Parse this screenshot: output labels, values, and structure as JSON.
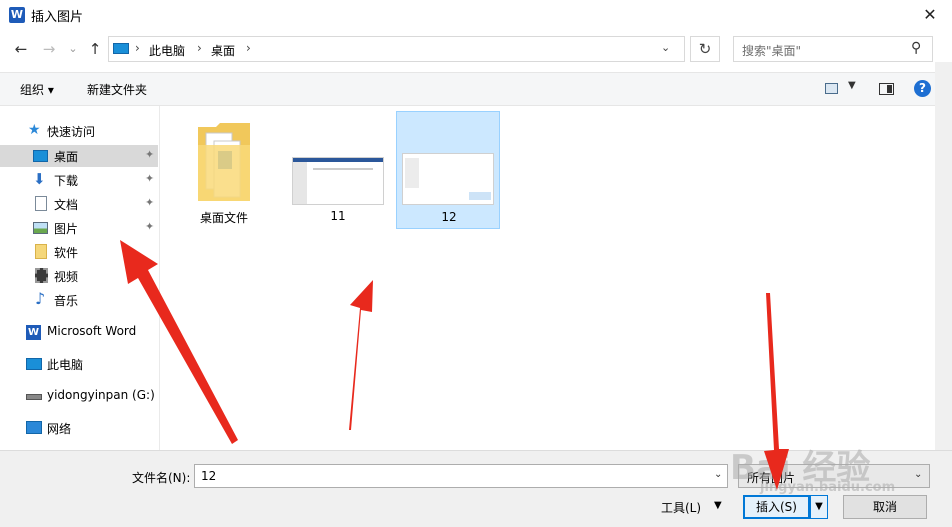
{
  "window": {
    "title": "插入图片",
    "app_icon_letter": "W",
    "close_glyph": "✕"
  },
  "address": {
    "crumbs": [
      "此电脑",
      "桌面"
    ],
    "separator": "›",
    "dropdown_glyph": "⌄",
    "refresh_glyph": "↻",
    "back_glyph": "←",
    "forward_glyph": "→",
    "recent_glyph": "⌄",
    "up_glyph": "↑"
  },
  "search": {
    "placeholder": "搜索\"桌面\"",
    "icon_glyph": "⚲"
  },
  "toolbar": {
    "organize": "组织 ▾",
    "new_folder": "新建文件夹",
    "view_drop": "▼",
    "help": "?"
  },
  "sidebar": {
    "items": [
      {
        "label": "快速访问",
        "icon": "star-icon",
        "pinned": false
      },
      {
        "label": "桌面",
        "icon": "desktop-icon",
        "pinned": true,
        "selected": true
      },
      {
        "label": "下载",
        "icon": "download-icon",
        "pinned": true
      },
      {
        "label": "文档",
        "icon": "document-icon",
        "pinned": true
      },
      {
        "label": "图片",
        "icon": "pictures-icon",
        "pinned": true
      },
      {
        "label": "软件",
        "icon": "folder-icon",
        "pinned": false
      },
      {
        "label": "视频",
        "icon": "video-icon",
        "pinned": false
      },
      {
        "label": "音乐",
        "icon": "music-icon",
        "pinned": false
      },
      {
        "label": "Microsoft Word",
        "icon": "word-icon",
        "pinned": false
      },
      {
        "label": "此电脑",
        "icon": "computer-icon",
        "pinned": false
      },
      {
        "label": "yidongyinpan (G:)",
        "icon": "drive-icon",
        "pinned": false
      },
      {
        "label": "网络",
        "icon": "network-icon",
        "pinned": false
      }
    ],
    "pin_glyph": "📌"
  },
  "files": [
    {
      "name": "桌面文件",
      "kind": "folder"
    },
    {
      "name": "11",
      "kind": "image"
    },
    {
      "name": "12",
      "kind": "image",
      "selected": true
    }
  ],
  "bottom": {
    "filename_label": "文件名(N):",
    "filename_value": "12",
    "filetype_value": "所有图片",
    "tools": "工具(L)",
    "tools_drop": "▼",
    "insert": "插入(S)",
    "insert_drop": "▼",
    "cancel": "取消",
    "drop_glyph": "⌄"
  },
  "watermark": {
    "main": "Bai 经验",
    "sub": "jingyan.baidu.com"
  },
  "colors": {
    "accent": "#0078d7",
    "selection": "#cce8ff",
    "annotation_arrow": "#e8291d"
  }
}
